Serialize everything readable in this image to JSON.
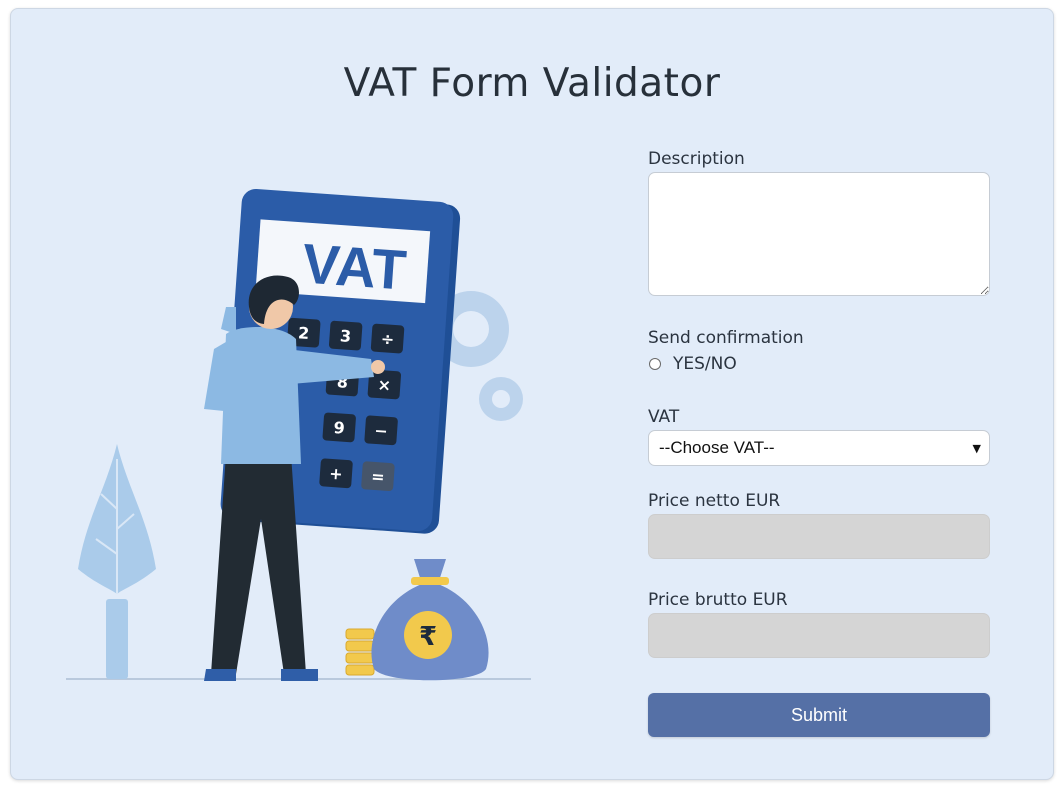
{
  "title": "VAT Form Validator",
  "form": {
    "description_label": "Description",
    "description_value": "",
    "confirmation_label": "Send confirmation",
    "confirmation_option": "YES/NO",
    "vat_label": "VAT",
    "vat_selected": "--Choose VAT--",
    "price_netto_label": "Price netto EUR",
    "price_netto_value": "",
    "price_brutto_label": "Price brutto EUR",
    "price_brutto_value": "",
    "submit_label": "Submit"
  },
  "illustration": {
    "calculator_text": "VAT",
    "keys": [
      "2",
      "3",
      "÷",
      "8",
      "×",
      "9",
      "−",
      "+",
      "="
    ],
    "currency_symbol": "₹"
  },
  "colors": {
    "background": "#e2ecf9",
    "submit": "#5570a6",
    "readonly_field": "#d5d5d5",
    "calculator": "#2b5ca8"
  }
}
